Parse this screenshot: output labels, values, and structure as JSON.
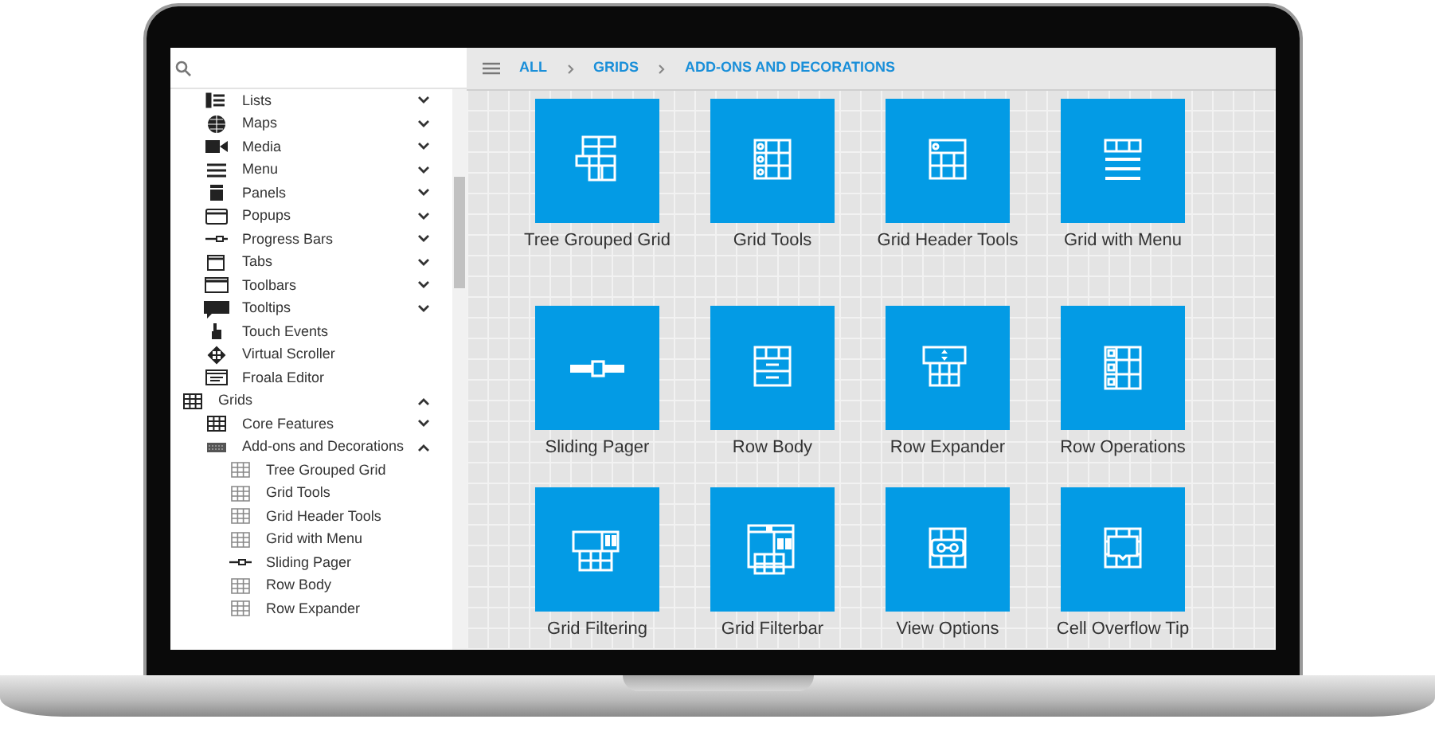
{
  "sidebar": {
    "orphan_items": [
      {
        "label": "Lists",
        "expanded": false
      },
      {
        "label": "Maps",
        "expanded": false
      },
      {
        "label": "Media",
        "expanded": false
      },
      {
        "label": "Menu",
        "expanded": false
      },
      {
        "label": "Panels",
        "expanded": false
      },
      {
        "label": "Popups",
        "expanded": false
      },
      {
        "label": "Progress Bars",
        "expanded": false
      },
      {
        "label": "Tabs",
        "expanded": false
      },
      {
        "label": "Toolbars",
        "expanded": false
      },
      {
        "label": "Tooltips",
        "expanded": false
      },
      {
        "label": "Touch Events"
      },
      {
        "label": "Virtual Scroller"
      },
      {
        "label": "Froala Editor"
      }
    ],
    "items": [
      {
        "label": "Grids",
        "expanded": true,
        "children": [
          {
            "label": "Core Features",
            "expanded": false
          },
          {
            "label": "Add-ons and Decorations",
            "expanded": true,
            "children": [
              {
                "label": "Tree Grouped Grid"
              },
              {
                "label": "Grid Tools"
              },
              {
                "label": "Grid Header Tools"
              },
              {
                "label": "Grid with Menu"
              },
              {
                "label": "Sliding Pager"
              },
              {
                "label": "Row Body"
              },
              {
                "label": "Row Expander"
              }
            ]
          }
        ]
      }
    ]
  },
  "breadcrumb": [
    "ALL",
    "GRIDS",
    "ADD-ONS AND DECORATIONS"
  ],
  "tiles": [
    {
      "label": "Tree Grouped Grid"
    },
    {
      "label": "Grid Tools"
    },
    {
      "label": "Grid Header Tools"
    },
    {
      "label": "Grid with Menu"
    },
    {
      "label": "Sliding Pager"
    },
    {
      "label": "Row Body"
    },
    {
      "label": "Row Expander"
    },
    {
      "label": "Row Operations"
    },
    {
      "label": "Grid Filtering"
    },
    {
      "label": "Grid Filterbar"
    },
    {
      "label": "View Options"
    },
    {
      "label": "Cell Overflow Tip"
    }
  ]
}
